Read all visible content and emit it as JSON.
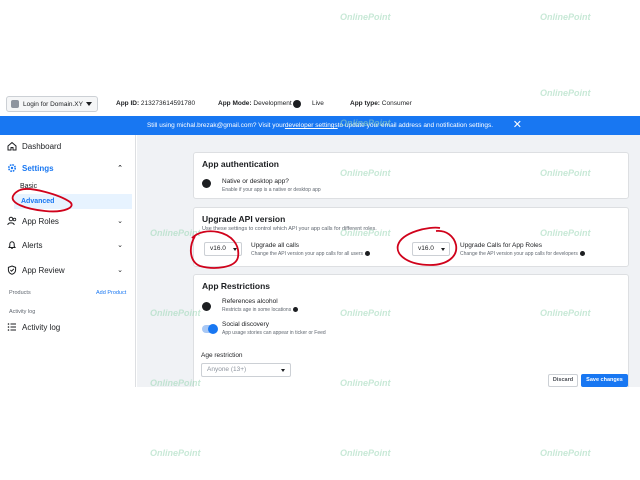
{
  "topbar": {
    "app_selector": "Login for Domain.XY",
    "app_id_label": "App ID:",
    "app_id_value": "213273614591780",
    "app_mode_label": "App Mode:",
    "app_mode_value": "Development",
    "app_mode_live": "Live",
    "app_type_label": "App type:",
    "app_type_value": "Consumer"
  },
  "banner": {
    "text_before": "Still using michal.brezak@gmail.com? Visit your ",
    "link": "developer settings",
    "text_after": " to update your email address and notification settings.",
    "close": "✕"
  },
  "sidebar": {
    "dashboard": "Dashboard",
    "settings": "Settings",
    "basic": "Basic",
    "advanced": "Advanced",
    "app_roles": "App Roles",
    "alerts": "Alerts",
    "app_review": "App Review",
    "products": "Products",
    "add_product": "Add Product",
    "activity_log_section": "Activity log",
    "activity_log": "Activity log"
  },
  "app_auth": {
    "title": "App authentication",
    "option_label": "Native or desktop app?",
    "option_desc": "Enable if your app is a native or desktop app"
  },
  "upgrade_api": {
    "title": "Upgrade API version",
    "subtitle": "Use these settings to control which API your app calls for different roles.",
    "all_calls_version": "v16.0",
    "all_calls_label": "Upgrade all calls",
    "all_calls_desc": "Change the API version your app calls for all users",
    "roles_version": "v16.0",
    "roles_label": "Upgrade Calls for App Roles",
    "roles_desc": "Change the API version your app calls for developers"
  },
  "restrictions": {
    "title": "App Restrictions",
    "alcohol_label": "References alcohol",
    "alcohol_desc": "Restricts age in some locations",
    "social_label": "Social discovery",
    "social_desc": "App usage stories can appear in ticker or Feed",
    "age_label": "Age restriction",
    "age_value": "Anyone (13+)"
  },
  "actions": {
    "discard": "Discard",
    "save": "Save changes"
  },
  "watermark": "OnlinePoint",
  "colors": {
    "accent": "#1877f2",
    "annotation": "#d0021b",
    "page_bg": "#f0f2f5"
  }
}
